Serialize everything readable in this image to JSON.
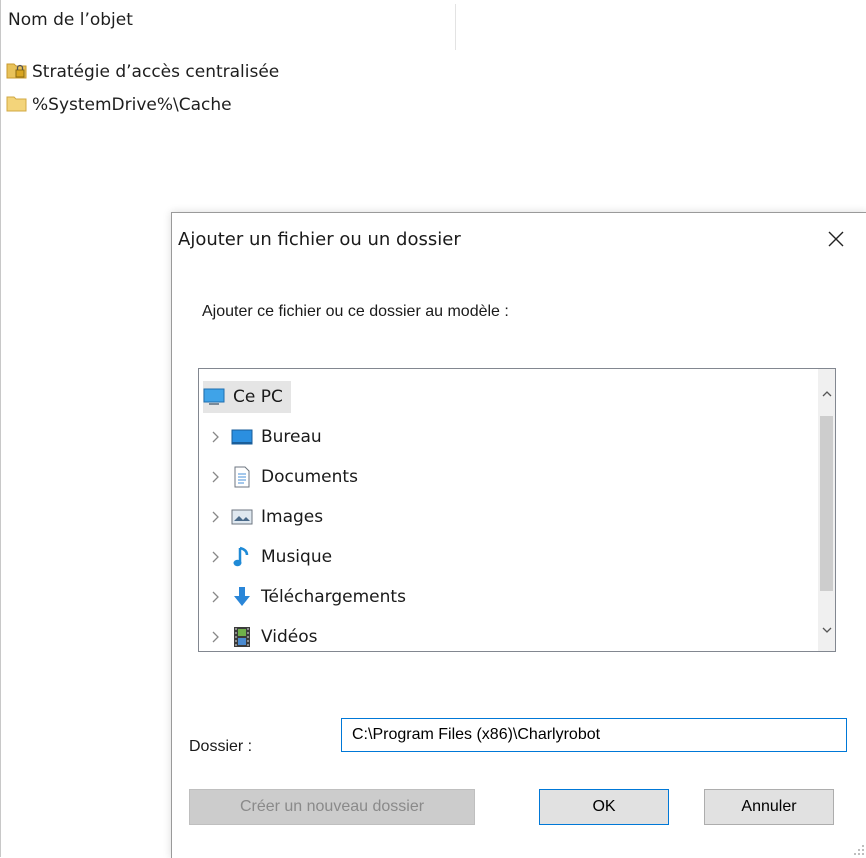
{
  "background": {
    "column_header": "Nom de l’objet",
    "items": [
      {
        "label": "Stratégie d’accès centralisée",
        "icon": "locked-folder-icon"
      },
      {
        "label": "%SystemDrive%\\Cache",
        "icon": "folder-icon"
      }
    ]
  },
  "dialog": {
    "title": "Ajouter un fichier ou un dossier",
    "close_glyph": "✕",
    "instruction": "Ajouter ce fichier ou ce dossier au modèle :",
    "tree": {
      "root": {
        "label": "Ce PC",
        "icon": "computer-icon"
      },
      "children": [
        {
          "label": "Bureau",
          "icon": "desktop-icon"
        },
        {
          "label": "Documents",
          "icon": "documents-icon"
        },
        {
          "label": "Images",
          "icon": "pictures-icon"
        },
        {
          "label": "Musique",
          "icon": "music-icon"
        },
        {
          "label": "Téléchargements",
          "icon": "downloads-icon"
        },
        {
          "label": "Vidéos",
          "icon": "videos-icon"
        }
      ]
    },
    "folder_label": "Dossier :",
    "folder_value": "C:\\Program Files (x86)\\Charlyrobot",
    "buttons": {
      "new_folder": "Créer un nouveau dossier",
      "ok": "OK",
      "cancel": "Annuler"
    },
    "colors": {
      "accent": "#0078d7",
      "selection": "#e5e5e5"
    }
  }
}
